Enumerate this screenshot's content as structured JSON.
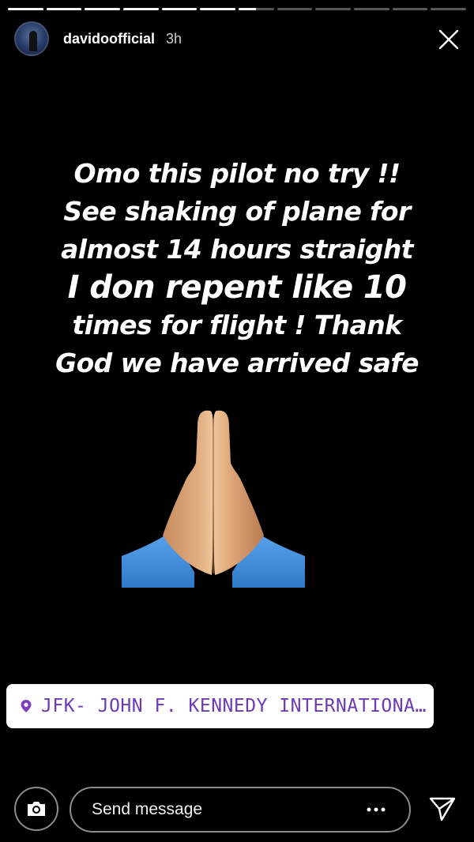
{
  "progress": {
    "segments_total": 12,
    "completed_segments": 6,
    "current_segment_fraction": 0.5
  },
  "header": {
    "username": "davidoofficial",
    "time": "3h"
  },
  "story": {
    "caption_lines": [
      "Omo this pilot no try !!",
      "See shaking of plane for",
      "almost 14 hours straight",
      "I don repent like 10",
      "times for flight ! Thank",
      "God we have arrived safe"
    ],
    "emoji": "folded-hands-icon"
  },
  "location_sticker": {
    "text": "JFK-  JOHN F. KENNEDY INTERNATIONAL AI..."
  },
  "bottom_bar": {
    "message_placeholder": "Send message"
  },
  "colors": {
    "background": "#000000",
    "location_text": "#6c3bb3",
    "sleeve": "#3f8bd9",
    "skin": "#d8a274"
  }
}
